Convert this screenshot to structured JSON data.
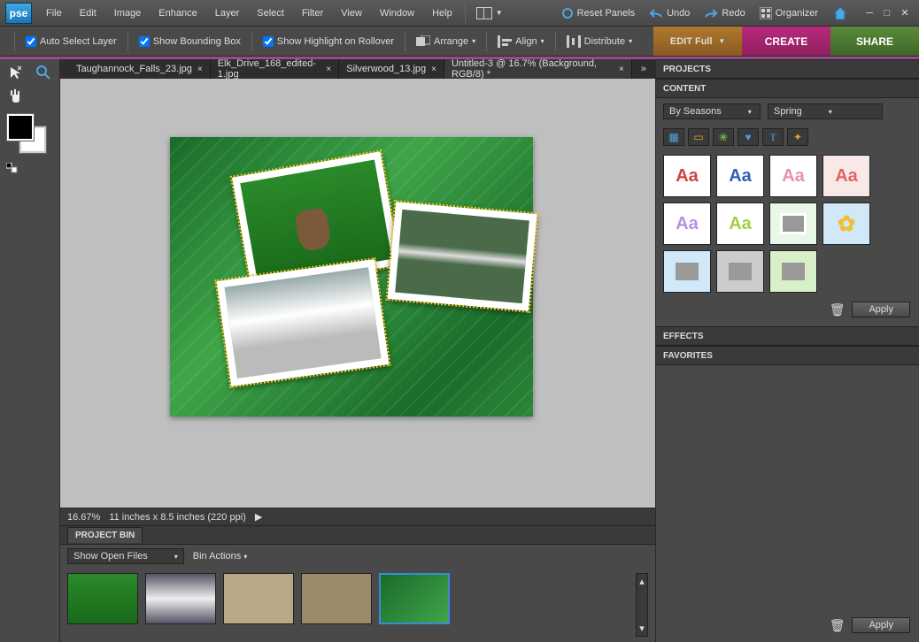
{
  "menu": [
    "File",
    "Edit",
    "Image",
    "Enhance",
    "Layer",
    "Select",
    "Filter",
    "View",
    "Window",
    "Help"
  ],
  "top_buttons": {
    "reset": "Reset Panels",
    "undo": "Undo",
    "redo": "Redo",
    "organizer": "Organizer"
  },
  "options": {
    "auto_select": "Auto Select Layer",
    "bounding": "Show Bounding Box",
    "highlight": "Show Highlight on Rollover",
    "arrange": "Arrange",
    "align": "Align",
    "distribute": "Distribute"
  },
  "modes": {
    "edit": "EDIT Full",
    "create": "CREATE",
    "share": "SHARE"
  },
  "tabs": [
    {
      "label": "Taughannock_Falls_23.jpg",
      "active": false
    },
    {
      "label": "Elk_Drive_168_edited-1.jpg",
      "active": false
    },
    {
      "label": "Silverwood_13.jpg",
      "active": false
    },
    {
      "label": "Untitled-3 @ 16.7% (Background, RGB/8) *",
      "active": true
    }
  ],
  "status": {
    "zoom": "16.67%",
    "dims": "11 inches x 8.5 inches (220 ppi)"
  },
  "bin": {
    "header": "PROJECT BIN",
    "show": "Show Open Files",
    "actions": "Bin Actions"
  },
  "panels": {
    "projects": "PROJECTS",
    "content": "CONTENT",
    "effects": "EFFECTS",
    "favorites": "FAVORITES",
    "content_filter1": "By Seasons",
    "content_filter2": "Spring",
    "apply": "Apply"
  }
}
